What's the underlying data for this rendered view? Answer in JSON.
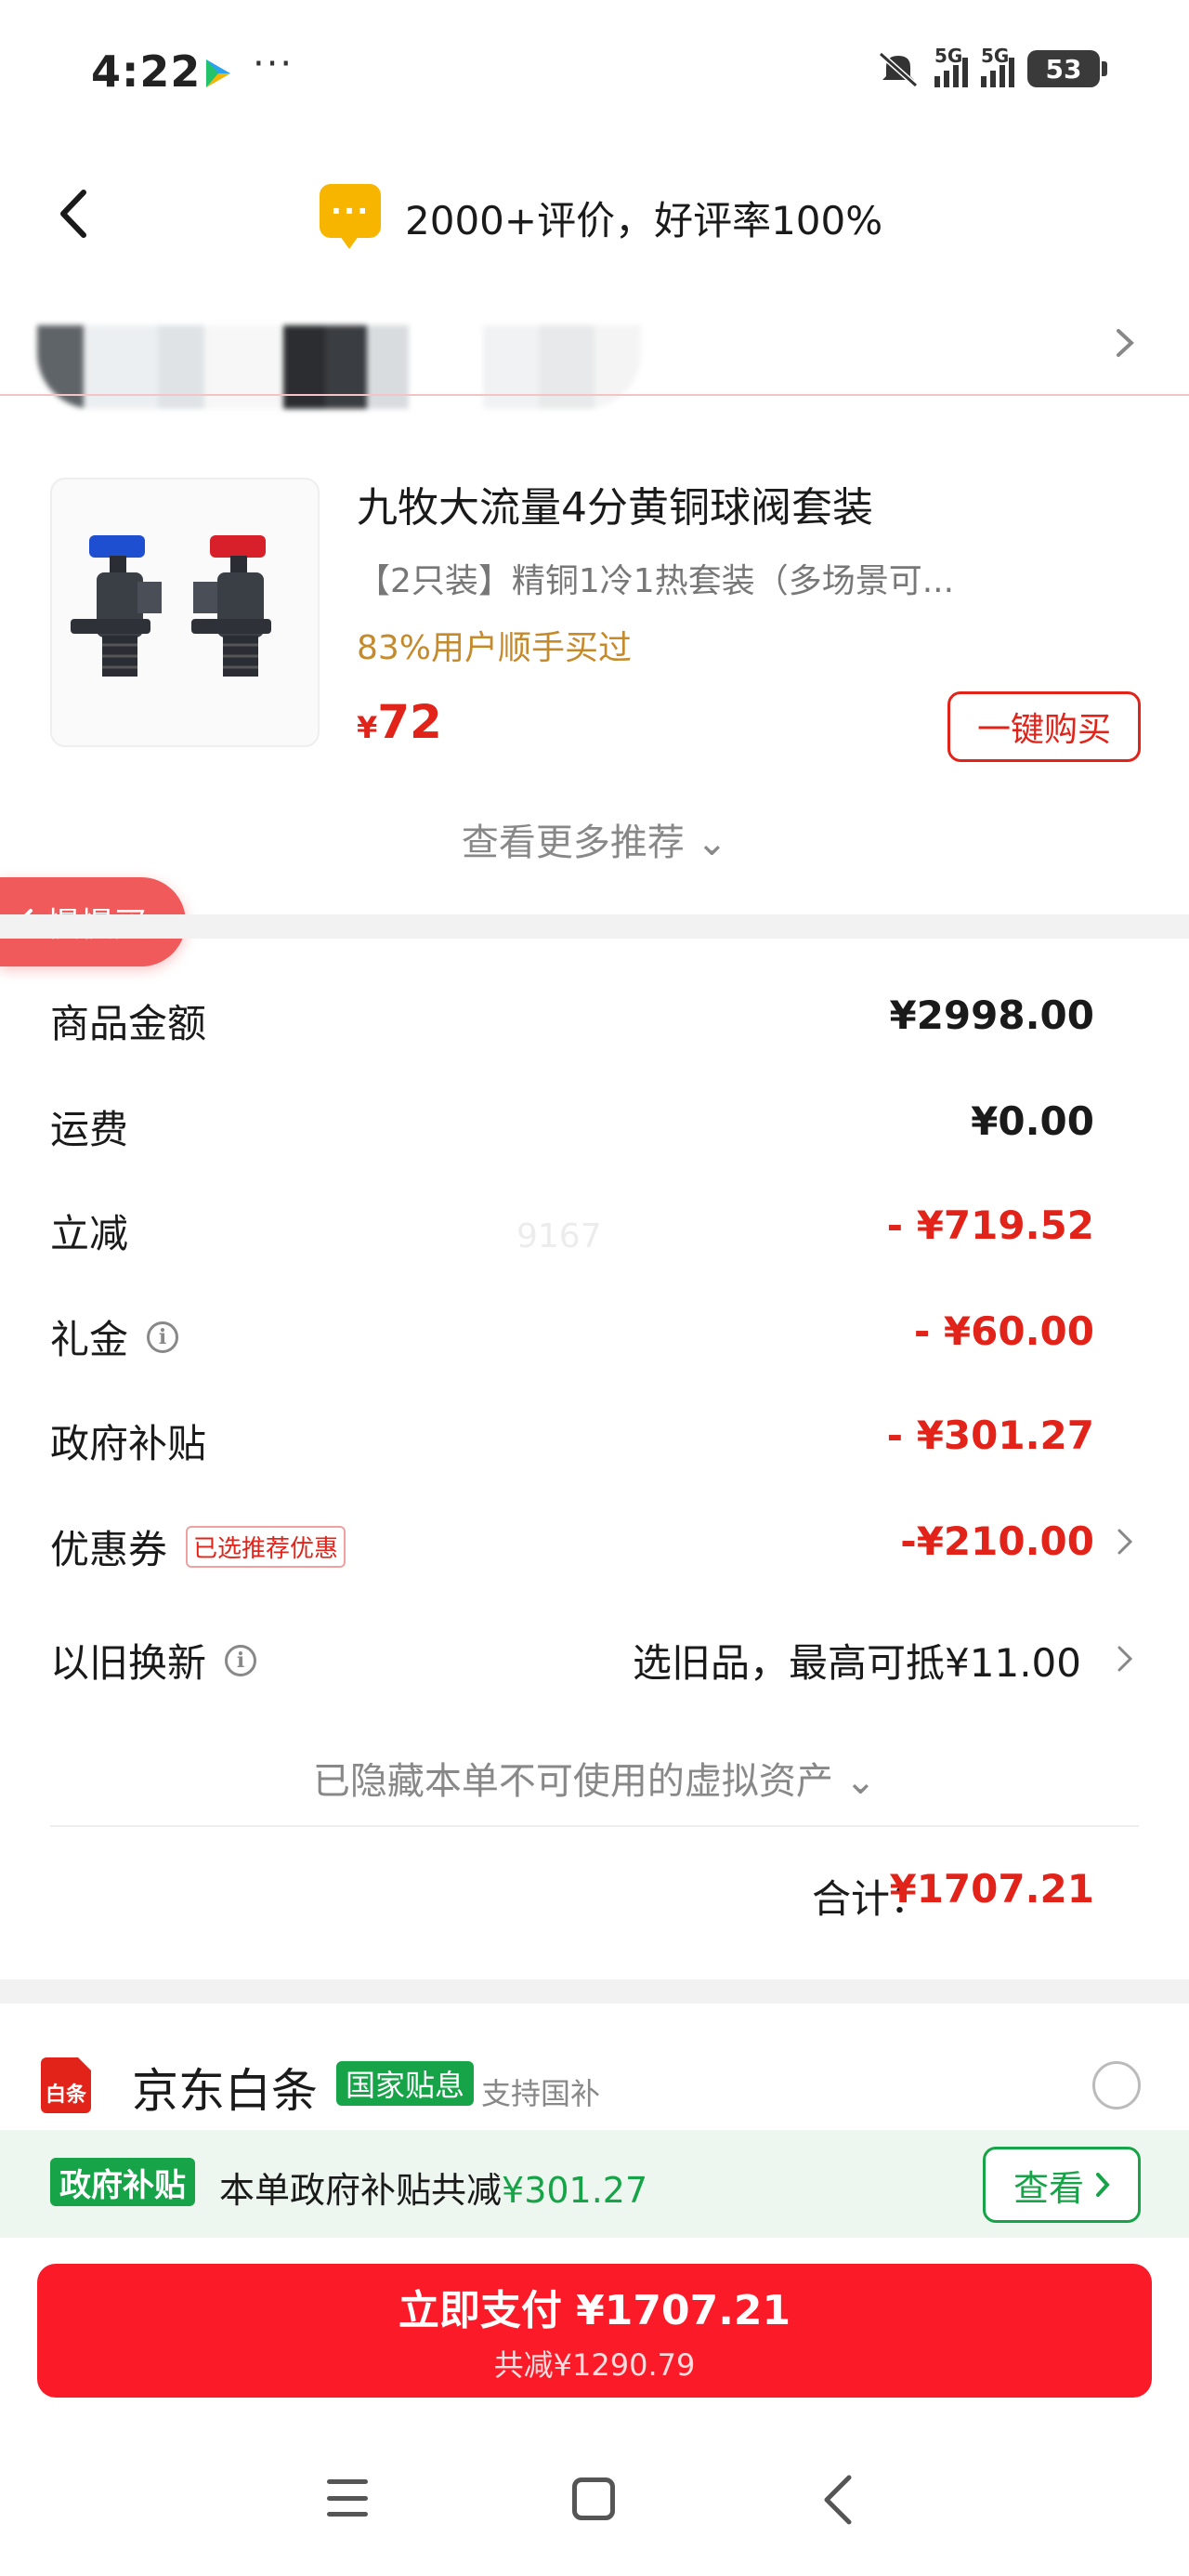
{
  "status_bar": {
    "time": "4:22",
    "dots": "···",
    "net1": "5G",
    "net2": "5G",
    "battery": "53"
  },
  "header": {
    "rating_bubble": "···",
    "rating_text": "2000+评价，好评率100%"
  },
  "product": {
    "title": "九牧大流量4分黄铜球阀套装",
    "subtitle": "【2只装】精铜1冷1热套装（多场景可...",
    "tag": "83%用户顺手买过",
    "currency": "¥",
    "price": "72",
    "buy_label": "一键购买",
    "more_label": "查看更多推荐 ⌄"
  },
  "slow_buy": {
    "label": "慢慢买"
  },
  "watermark": "9167",
  "price_rows": [
    {
      "label": "商品金额",
      "value": "¥2998.00"
    },
    {
      "label": "运费",
      "value": "¥0.00"
    },
    {
      "label": "立减",
      "value": "- ¥719.52"
    },
    {
      "label": "礼金",
      "value": "- ¥60.00"
    },
    {
      "label": "政府补贴",
      "value": "- ¥301.27"
    },
    {
      "label": "优惠券",
      "badge": "已选推荐优惠",
      "value": "-¥210.00"
    },
    {
      "label": "以旧换新",
      "value": "选旧品，最高可抵¥11.00"
    }
  ],
  "hidden_assets": "已隐藏本单不可使用的虚拟资产 ⌄",
  "total": {
    "label": "合计：",
    "value": "¥1707.21"
  },
  "payment": {
    "icon_text": "白条",
    "name": "京东白条",
    "badge": "国家贴息",
    "support": "支持国补"
  },
  "subsidy": {
    "badge": "政府补贴",
    "text_prefix": "本单政府补贴共减",
    "amount": "¥301.27",
    "view_label": "查看"
  },
  "pay_button": {
    "main": "立即支付 ¥1707.21",
    "sub": "共减¥1290.79"
  },
  "colors": {
    "jd_red": "#e2231a",
    "pay_red": "#fa1a28",
    "green": "#17a348",
    "gold": "#c58a2c"
  }
}
